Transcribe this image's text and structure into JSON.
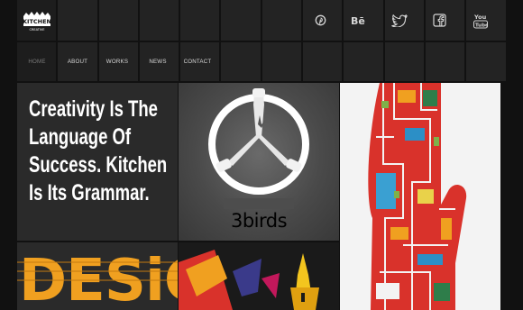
{
  "brand": {
    "logo_text": "KITCHEN",
    "logo_sub": "CREATIVE"
  },
  "social": [
    {
      "name": "pinterest-icon",
      "glyph": "℗"
    },
    {
      "name": "behance-icon",
      "glyph": "Bē"
    },
    {
      "name": "twitter-icon",
      "glyph": ""
    },
    {
      "name": "facebook-icon",
      "glyph": "f"
    },
    {
      "name": "youtube-icon",
      "glyph": "You Tube"
    }
  ],
  "nav": {
    "home": "HOME",
    "about": "ABOUT",
    "works": "WORKS",
    "news": "NEWS",
    "contact": "CONTACT"
  },
  "hero": {
    "line1": "Creativity Is The",
    "line2": "Language Of",
    "line3": "Success. Kitchen",
    "line4": "Is Its Grammar."
  },
  "works": {
    "birds_label": "3birds",
    "desig_label": "DESiG"
  },
  "colors": {
    "background": "#111111",
    "tile": "#232323",
    "hero_bg": "#2a2a2a",
    "accent_red": "#e0362c",
    "accent_orange": "#f0a020"
  }
}
